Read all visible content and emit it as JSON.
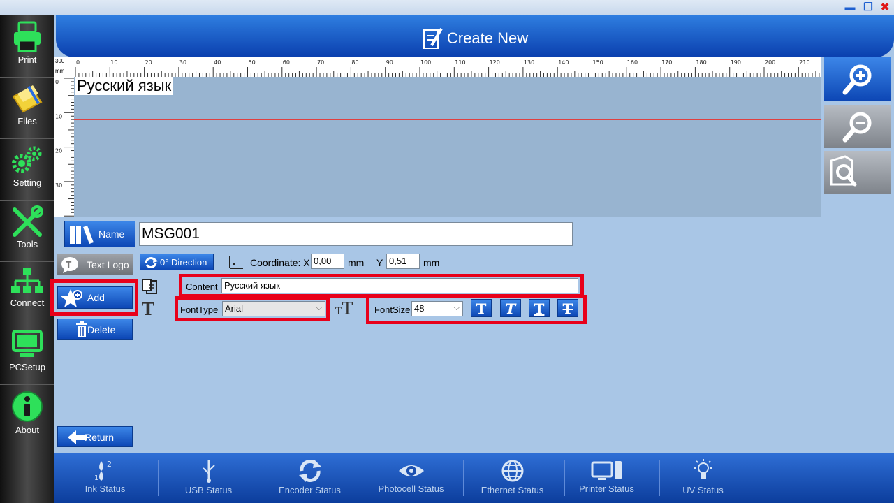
{
  "header": {
    "title": "Create New"
  },
  "sidebar": {
    "items": [
      {
        "label": "Print"
      },
      {
        "label": "Files"
      },
      {
        "label": "Setting"
      },
      {
        "label": "Tools"
      },
      {
        "label": "Connect"
      },
      {
        "label": "PCSetup"
      },
      {
        "label": "About"
      }
    ]
  },
  "ruler": {
    "unit": "mm",
    "corner": "300",
    "h_ticks": [
      "0",
      "10",
      "20",
      "30",
      "40",
      "50",
      "60",
      "70",
      "80",
      "90",
      "100",
      "110",
      "120",
      "130",
      "140",
      "150",
      "160",
      "170",
      "180",
      "190",
      "200",
      "210"
    ],
    "v_ticks": [
      "0",
      "10",
      "20",
      "30"
    ]
  },
  "canvas": {
    "text": "Русский язык"
  },
  "form": {
    "name_label": "Name",
    "name_value": "MSG001",
    "text_logo_label": "Text Logo",
    "direction_label": "0° Direction",
    "coordinate_label": "Coordinate: X",
    "x_value": "0,00",
    "x_unit": "mm",
    "y_label": "Y",
    "y_value": "0,51",
    "y_unit": "mm",
    "add_label": "Add",
    "delete_label": "Delete",
    "return_label": "Return",
    "content_label": "Content",
    "content_value": "Русский язык",
    "fonttype_label": "FontType",
    "fonttype_value": "Arial",
    "fontsize_label": "FontSize",
    "fontsize_value": "48",
    "format_buttons": [
      "T",
      "T",
      "T",
      "T"
    ]
  },
  "status": {
    "items": [
      {
        "label": "Ink Status"
      },
      {
        "label": "USB Status"
      },
      {
        "label": "Encoder Status"
      },
      {
        "label": "Photocell Status"
      },
      {
        "label": "Ethernet Status"
      },
      {
        "label": "Printer Status"
      },
      {
        "label": "UV Status"
      }
    ]
  },
  "colors": {
    "accent": "#0d47b5",
    "highlight": "#e8001a",
    "sidebar_icon": "#2ee05a"
  }
}
